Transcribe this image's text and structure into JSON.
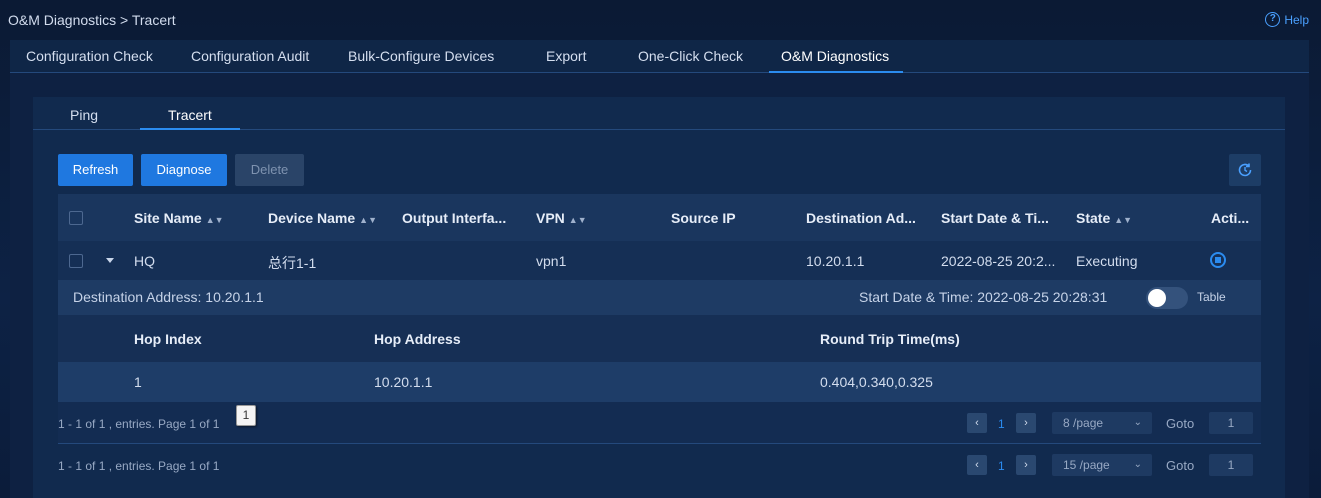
{
  "breadcrumb": "O&M Diagnostics > Tracert",
  "help_label": "Help",
  "main_tabs": [
    "Configuration Check",
    "Configuration Audit",
    "Bulk-Configure Devices",
    "Export",
    "One-Click Check",
    "O&M Diagnostics"
  ],
  "active_main_tab": "O&M Diagnostics",
  "sub_tabs": [
    "Ping",
    "Tracert"
  ],
  "active_sub_tab": "Tracert",
  "toolbar": {
    "refresh": "Refresh",
    "diagnose": "Diagnose",
    "delete": "Delete"
  },
  "columns": [
    "Site Name",
    "Device Name",
    "Output Interfa...",
    "VPN",
    "Source IP",
    "Destination Ad...",
    "Start Date & Ti...",
    "State",
    "Acti..."
  ],
  "row": {
    "site": "HQ",
    "device": "总行1-1",
    "output_interface": "",
    "vpn": "vpn1",
    "source_ip": "",
    "destination": "10.20.1.1",
    "start": "2022-08-25 20:2...",
    "state": "Executing"
  },
  "detail": {
    "destination_label": "Destination Address: 10.20.1.1",
    "start_label": "Start Date & Time: 2022-08-25 20:28:31",
    "toggle_label": "Table",
    "hop_columns": [
      "Hop Index",
      "Hop Address",
      "Round Trip Time(ms)"
    ],
    "hops": [
      {
        "index": "1",
        "address": "10.20.1.1",
        "rtt": "0.404,0.340,0.325"
      }
    ]
  },
  "inner_pager": {
    "info": "1 - 1 of 1 , entries. Page 1 of 1",
    "page": "1",
    "per_page": "8 /page",
    "goto_label": "Goto",
    "goto_value": "1",
    "tooltip": "1"
  },
  "outer_pager": {
    "info": "1 - 1 of 1 , entries. Page 1 of 1",
    "page": "1",
    "per_page": "15 /page",
    "goto_label": "Goto",
    "goto_value": "1"
  }
}
